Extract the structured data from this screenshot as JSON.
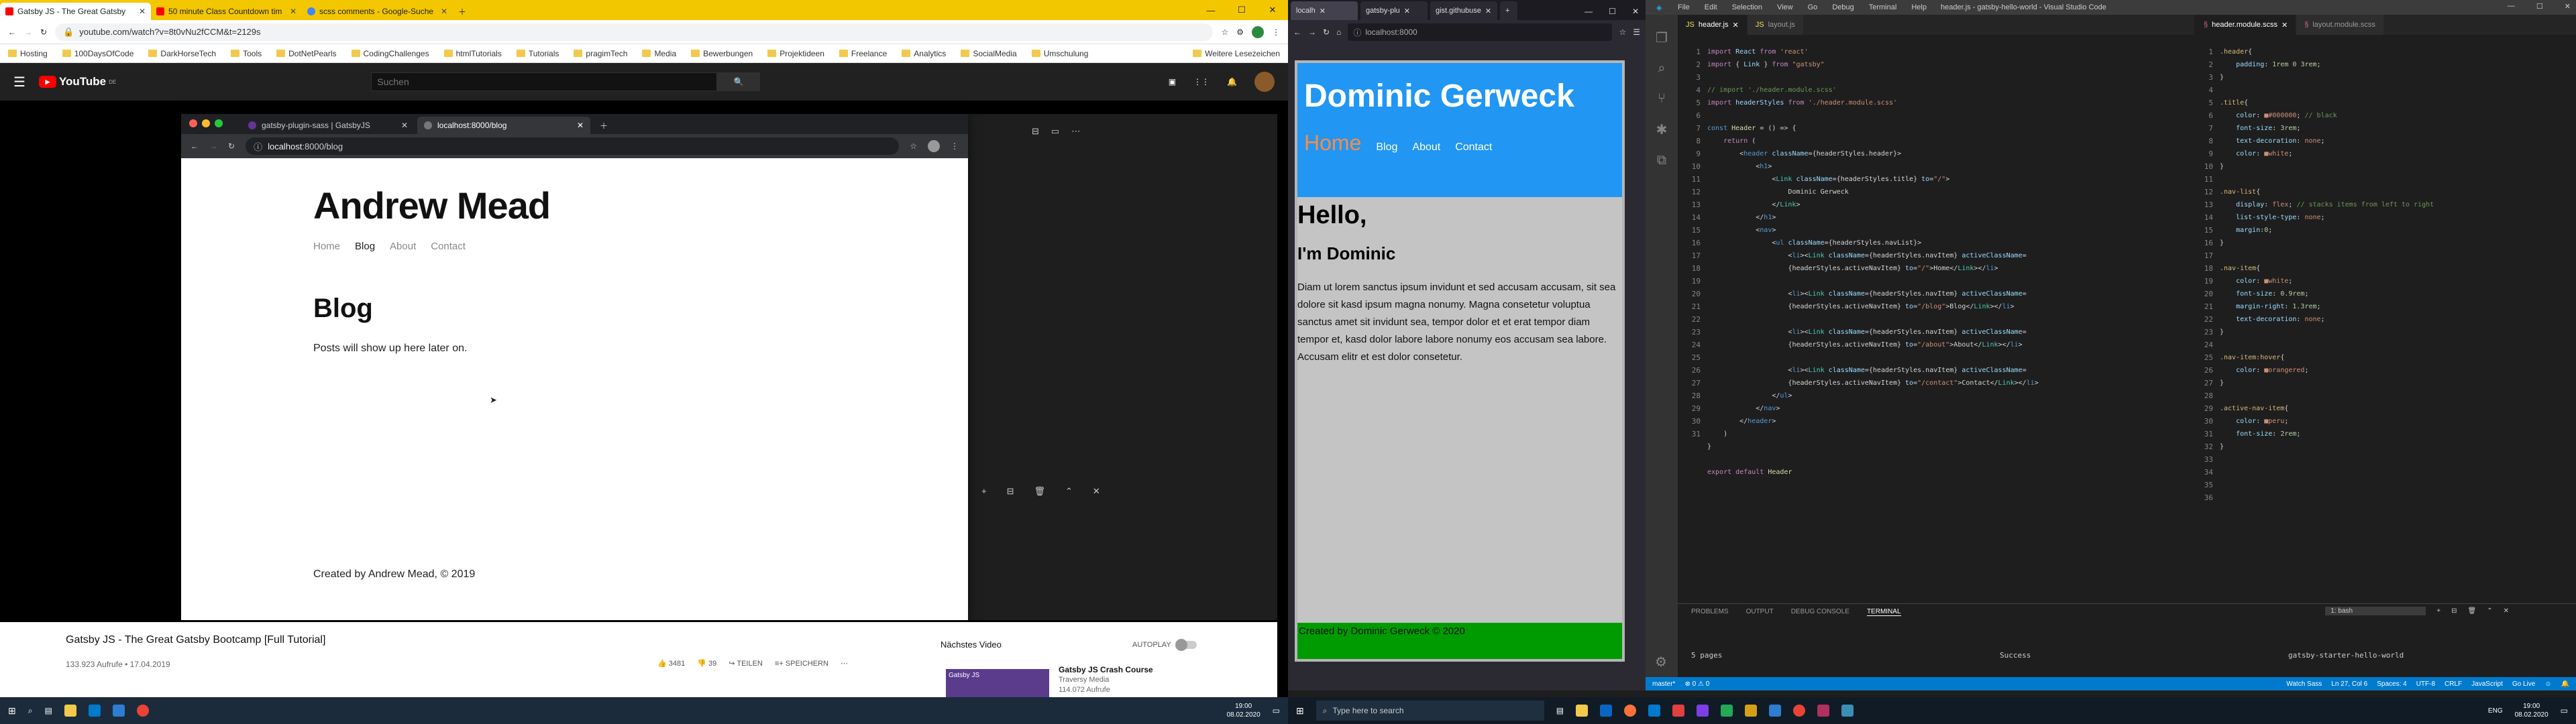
{
  "left": {
    "tabs": [
      {
        "title": "Gatsby JS - The Great Gatsby",
        "color": "#ff0000"
      },
      {
        "title": "50 minute Class Countdown tim",
        "color": "#ff0000"
      },
      {
        "title": "scss comments - Google-Suche",
        "color": "#4285f4"
      }
    ],
    "url": "youtube.com/watch?v=8t0vNu2fCCM&t=2129s",
    "bookmarks": [
      "Hosting",
      "100DaysOfCode",
      "DarkHorseTech",
      "Tools",
      "DotNetPearls",
      "CodingChallenges",
      "htmlTutorials",
      "Tutorials",
      "pragimTech",
      "Media",
      "Bewerbungen",
      "Projektideen",
      "Freelance",
      "Analytics",
      "SocialMedia",
      "Umschulung"
    ],
    "other_bookmarks": "Weitere Lesezeichen",
    "youtube": {
      "logo": "YouTube",
      "region": "DE",
      "search_placeholder": "Suchen",
      "video_title": "Gatsby JS - The Great Gatsby Bootcamp [Full Tutorial]",
      "views": "133.923 Aufrufe • 17.04.2019",
      "likes": "3481",
      "dislikes": "39",
      "share": "TEILEN",
      "save": "SPEICHERN",
      "next_label": "Nächstes Video",
      "autoplay": "AUTOPLAY",
      "next_title": "Gatsby JS Crash Course",
      "next_channel": "Traversy Media",
      "next_views": "114.072 Aufrufe",
      "thumb_text": "Gatsby JS"
    },
    "float": {
      "tabs": [
        "gatsby-plugin-sass | GatsbyJS",
        "localhost:8000/blog"
      ],
      "url_host": "localhost",
      "url_path": ":8000/blog",
      "site_title": "Andrew Mead",
      "nav": [
        "Home",
        "Blog",
        "About",
        "Contact"
      ],
      "heading": "Blog",
      "body": "Posts will show up here later on.",
      "footer": "Created by Andrew Mead, © 2019"
    },
    "clock": {
      "time": "19:00",
      "date": "08.02.2020"
    }
  },
  "right": {
    "ff_tabs": [
      "localh",
      "gatsby-plu",
      "gist.githubuse"
    ],
    "ff_url": "localhost:8000",
    "dg": {
      "title": "Dominic Gerweck",
      "nav": [
        "Home",
        "Blog",
        "About",
        "Contact"
      ],
      "hello": "Hello,",
      "im": "I'm Dominic",
      "lorem": "Diam ut lorem sanctus ipsum invidunt et sed accusam accusam, sit sea dolore sit kasd ipsum magna nonumy. Magna consetetur voluptua sanctus amet sit invidunt sea, tempor dolor et et erat tempor diam tempor et, kasd dolor labore labore nonumy eos accusam sea labore. Accusam elitr et est dolor consetetur.",
      "footer": "Created by Dominic Gerweck © 2020"
    },
    "vscode": {
      "menu": [
        "File",
        "Edit",
        "Selection",
        "View",
        "Go",
        "Debug",
        "Terminal",
        "Help"
      ],
      "window_title": "header.js - gatsby-hello-world - Visual Studio Code",
      "tabs_left": [
        "header.js",
        "layout.js"
      ],
      "tabs_right": [
        "header.module.scss",
        "layout.module.scss"
      ],
      "panel_tabs": [
        "PROBLEMS",
        "OUTPUT",
        "DEBUG CONSOLE",
        "TERMINAL"
      ],
      "terminal_select": "1: bash",
      "terminal_lines": [
        "5 pages",
        "Success",
        "gatsby-starter-hello-world"
      ],
      "status_left": [
        "master*",
        "⊗ 0 ⚠ 0"
      ],
      "status_right": [
        "Watch Sass",
        "Ln 27, Col 6",
        "Spaces: 4",
        "UTF-8",
        "CRLF",
        "JavaScript",
        "Go Live"
      ]
    },
    "clock": {
      "time": "19:00",
      "date": "08.02.2020"
    },
    "search_placeholder": "Type here to search",
    "lang": "ENG"
  }
}
